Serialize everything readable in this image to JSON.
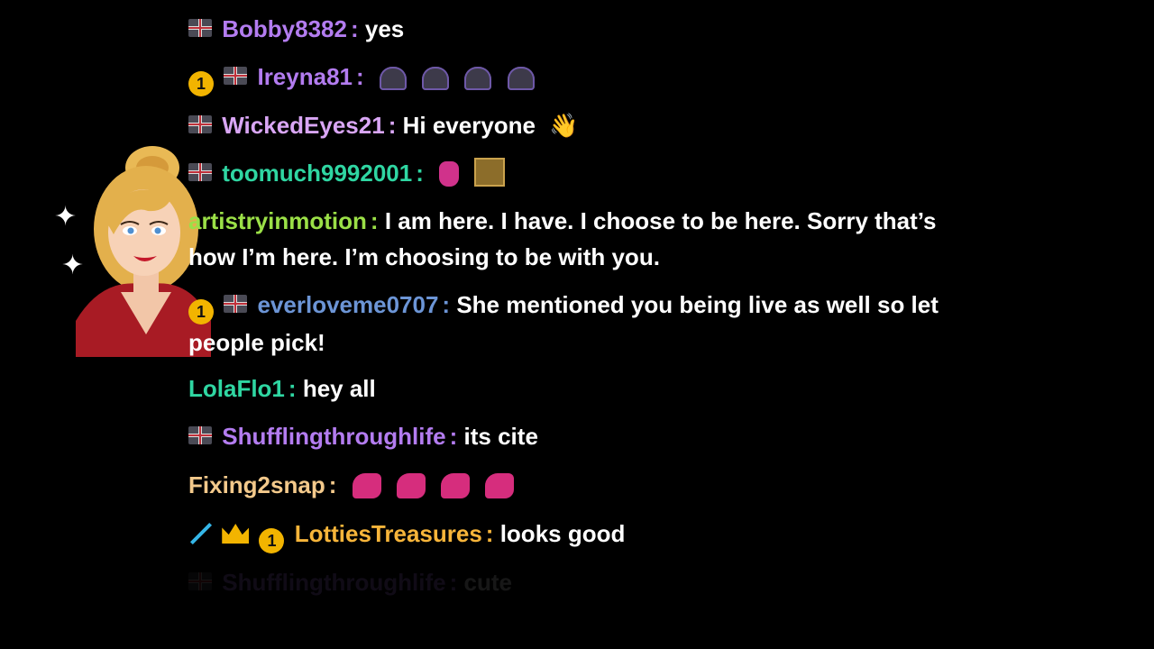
{
  "messages": [
    {
      "badges": [
        "flag"
      ],
      "user": "Bobby8382",
      "color": "#b37cf0",
      "text": "yes"
    },
    {
      "badges": [
        "coin",
        "flag"
      ],
      "coin_label": "1",
      "user": "Ireyna81",
      "color": "#b37cf0",
      "text": "",
      "emotes": [
        "ghost-emote",
        "ghost-emote",
        "ghost-emote",
        "ghost-emote"
      ]
    },
    {
      "badges": [
        "flag"
      ],
      "user": "WickedEyes21",
      "color": "#d9a6f5",
      "text": "Hi everyone",
      "suffix": "👋"
    },
    {
      "badges": [
        "flag"
      ],
      "user": "toomuch9992001",
      "color": "#2fd6a2",
      "text": "",
      "emotes": [
        "mask-emote",
        "box-emote"
      ]
    },
    {
      "badges": [],
      "user": "artistryinmotion",
      "color": "#9be047",
      "text": "I am here. I have. I choose to be here. Sorry that’s how I’m here. I’m choosing to be with you."
    },
    {
      "badges": [
        "coin",
        "flag"
      ],
      "coin_label": "1",
      "user": "everloveme0707",
      "color": "#6c95d6",
      "text": "She mentioned you being live as well so let people pick!"
    },
    {
      "badges": [],
      "user": "LolaFlo1",
      "color": "#2fd6a2",
      "text": "hey all"
    },
    {
      "badges": [
        "flag"
      ],
      "user": "Shufflingthroughlife",
      "color": "#b37cf0",
      "text": "its cite"
    },
    {
      "badges": [],
      "user": "Fixing2snap",
      "color": "#f3c98b",
      "text": "",
      "emotes": [
        "dino-emote",
        "dino-emote",
        "dino-emote",
        "dino-emote"
      ]
    },
    {
      "badges": [
        "sword",
        "crown",
        "coin"
      ],
      "coin_label": "1",
      "user": "LottiesTreasures",
      "color": "#f7b53a",
      "text": "looks good"
    },
    {
      "badges": [
        "flag"
      ],
      "user": "Shufflingthroughlife",
      "color": "#b37cf0",
      "text": "cute",
      "faded": true
    }
  ]
}
